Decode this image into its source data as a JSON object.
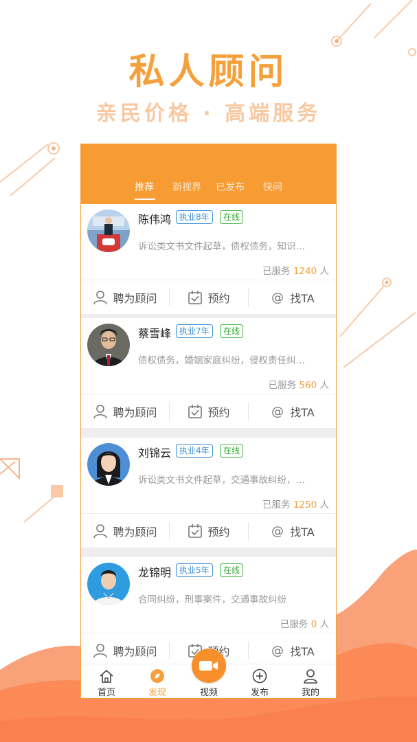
{
  "hero": {
    "title": "私人顾问",
    "subtitle": "亲民价格 · 高端服务"
  },
  "colors": {
    "accent": "#f79b33",
    "badge_years": "#3b8fd8",
    "badge_online": "#4bb74b",
    "highlight": "#f5a03a"
  },
  "tabs": [
    {
      "label": "推荐",
      "active": true
    },
    {
      "label": "新视界",
      "active": false
    },
    {
      "label": "已发布",
      "active": false
    },
    {
      "label": "快问",
      "active": false
    }
  ],
  "served_prefix": "已服务",
  "served_suffix": "人",
  "actions": {
    "hire": "聘为顾问",
    "book": "预约",
    "find": "找TA"
  },
  "lawyers": [
    {
      "name": "陈伟鸿",
      "years": "执业8年",
      "status": "在线",
      "desc": "诉讼类文书文件起草，债权债务，知识…",
      "served": "1240"
    },
    {
      "name": "蔡雪峰",
      "years": "执业7年",
      "status": "在线",
      "desc": "债权债务，婚姻家庭纠纷，侵权责任纠…",
      "served": "560"
    },
    {
      "name": "刘锦云",
      "years": "执业4年",
      "status": "在线",
      "desc": "诉讼类文书文件起草，交通事故纠纷，…",
      "served": "1250"
    },
    {
      "name": "龙锦明",
      "years": "执业5年",
      "status": "在线",
      "desc": "合同纠纷，刑事案件，交通事故纠纷",
      "served": "0"
    }
  ],
  "bottom_nav": [
    {
      "label": "首页",
      "icon": "home-icon"
    },
    {
      "label": "发现",
      "icon": "compass-icon",
      "active": true
    },
    {
      "label": "视频",
      "icon": "video-camera-icon"
    },
    {
      "label": "发布",
      "icon": "plus-circle-icon"
    },
    {
      "label": "我的",
      "icon": "user-icon"
    }
  ]
}
